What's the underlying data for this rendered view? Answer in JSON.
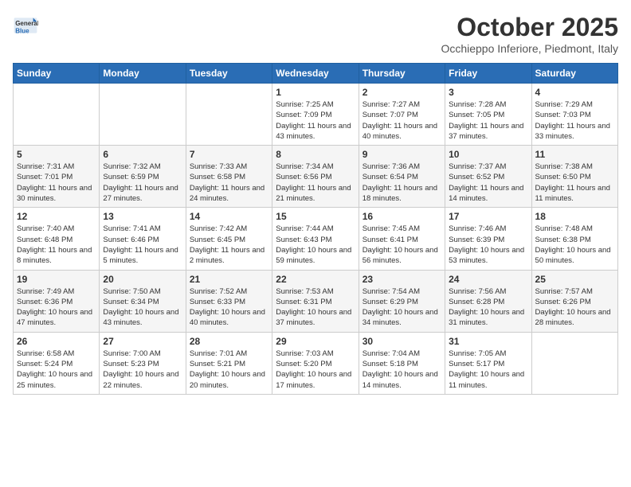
{
  "header": {
    "logo_general": "General",
    "logo_blue": "Blue",
    "month_title": "October 2025",
    "location": "Occhieppo Inferiore, Piedmont, Italy"
  },
  "days_of_week": [
    "Sunday",
    "Monday",
    "Tuesday",
    "Wednesday",
    "Thursday",
    "Friday",
    "Saturday"
  ],
  "weeks": [
    [
      {
        "day": "",
        "info": ""
      },
      {
        "day": "",
        "info": ""
      },
      {
        "day": "",
        "info": ""
      },
      {
        "day": "1",
        "info": "Sunrise: 7:25 AM\nSunset: 7:09 PM\nDaylight: 11 hours and 43 minutes."
      },
      {
        "day": "2",
        "info": "Sunrise: 7:27 AM\nSunset: 7:07 PM\nDaylight: 11 hours and 40 minutes."
      },
      {
        "day": "3",
        "info": "Sunrise: 7:28 AM\nSunset: 7:05 PM\nDaylight: 11 hours and 37 minutes."
      },
      {
        "day": "4",
        "info": "Sunrise: 7:29 AM\nSunset: 7:03 PM\nDaylight: 11 hours and 33 minutes."
      }
    ],
    [
      {
        "day": "5",
        "info": "Sunrise: 7:31 AM\nSunset: 7:01 PM\nDaylight: 11 hours and 30 minutes."
      },
      {
        "day": "6",
        "info": "Sunrise: 7:32 AM\nSunset: 6:59 PM\nDaylight: 11 hours and 27 minutes."
      },
      {
        "day": "7",
        "info": "Sunrise: 7:33 AM\nSunset: 6:58 PM\nDaylight: 11 hours and 24 minutes."
      },
      {
        "day": "8",
        "info": "Sunrise: 7:34 AM\nSunset: 6:56 PM\nDaylight: 11 hours and 21 minutes."
      },
      {
        "day": "9",
        "info": "Sunrise: 7:36 AM\nSunset: 6:54 PM\nDaylight: 11 hours and 18 minutes."
      },
      {
        "day": "10",
        "info": "Sunrise: 7:37 AM\nSunset: 6:52 PM\nDaylight: 11 hours and 14 minutes."
      },
      {
        "day": "11",
        "info": "Sunrise: 7:38 AM\nSunset: 6:50 PM\nDaylight: 11 hours and 11 minutes."
      }
    ],
    [
      {
        "day": "12",
        "info": "Sunrise: 7:40 AM\nSunset: 6:48 PM\nDaylight: 11 hours and 8 minutes."
      },
      {
        "day": "13",
        "info": "Sunrise: 7:41 AM\nSunset: 6:46 PM\nDaylight: 11 hours and 5 minutes."
      },
      {
        "day": "14",
        "info": "Sunrise: 7:42 AM\nSunset: 6:45 PM\nDaylight: 11 hours and 2 minutes."
      },
      {
        "day": "15",
        "info": "Sunrise: 7:44 AM\nSunset: 6:43 PM\nDaylight: 10 hours and 59 minutes."
      },
      {
        "day": "16",
        "info": "Sunrise: 7:45 AM\nSunset: 6:41 PM\nDaylight: 10 hours and 56 minutes."
      },
      {
        "day": "17",
        "info": "Sunrise: 7:46 AM\nSunset: 6:39 PM\nDaylight: 10 hours and 53 minutes."
      },
      {
        "day": "18",
        "info": "Sunrise: 7:48 AM\nSunset: 6:38 PM\nDaylight: 10 hours and 50 minutes."
      }
    ],
    [
      {
        "day": "19",
        "info": "Sunrise: 7:49 AM\nSunset: 6:36 PM\nDaylight: 10 hours and 47 minutes."
      },
      {
        "day": "20",
        "info": "Sunrise: 7:50 AM\nSunset: 6:34 PM\nDaylight: 10 hours and 43 minutes."
      },
      {
        "day": "21",
        "info": "Sunrise: 7:52 AM\nSunset: 6:33 PM\nDaylight: 10 hours and 40 minutes."
      },
      {
        "day": "22",
        "info": "Sunrise: 7:53 AM\nSunset: 6:31 PM\nDaylight: 10 hours and 37 minutes."
      },
      {
        "day": "23",
        "info": "Sunrise: 7:54 AM\nSunset: 6:29 PM\nDaylight: 10 hours and 34 minutes."
      },
      {
        "day": "24",
        "info": "Sunrise: 7:56 AM\nSunset: 6:28 PM\nDaylight: 10 hours and 31 minutes."
      },
      {
        "day": "25",
        "info": "Sunrise: 7:57 AM\nSunset: 6:26 PM\nDaylight: 10 hours and 28 minutes."
      }
    ],
    [
      {
        "day": "26",
        "info": "Sunrise: 6:58 AM\nSunset: 5:24 PM\nDaylight: 10 hours and 25 minutes."
      },
      {
        "day": "27",
        "info": "Sunrise: 7:00 AM\nSunset: 5:23 PM\nDaylight: 10 hours and 22 minutes."
      },
      {
        "day": "28",
        "info": "Sunrise: 7:01 AM\nSunset: 5:21 PM\nDaylight: 10 hours and 20 minutes."
      },
      {
        "day": "29",
        "info": "Sunrise: 7:03 AM\nSunset: 5:20 PM\nDaylight: 10 hours and 17 minutes."
      },
      {
        "day": "30",
        "info": "Sunrise: 7:04 AM\nSunset: 5:18 PM\nDaylight: 10 hours and 14 minutes."
      },
      {
        "day": "31",
        "info": "Sunrise: 7:05 AM\nSunset: 5:17 PM\nDaylight: 10 hours and 11 minutes."
      },
      {
        "day": "",
        "info": ""
      }
    ]
  ]
}
